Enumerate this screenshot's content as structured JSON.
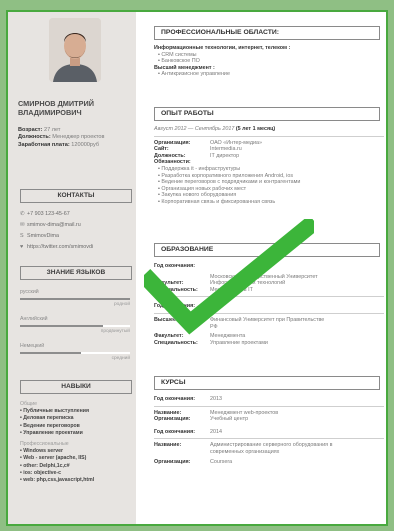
{
  "colors": {
    "accent": "#49a93f",
    "sidebar": "#e7e4e1",
    "background": "#8fbf84"
  },
  "profile": {
    "name": "СМИРНОВ ДМИТРИЙ ВЛАДИМИРОВИЧ",
    "age_label": "Возраст:",
    "age": "27 лет",
    "position_label": "Должность:",
    "position": "Менеджер проектов",
    "salary_label": "Заработная плата:",
    "salary": "120000руб"
  },
  "contacts": {
    "title": "КОНТАКТЫ",
    "items": [
      {
        "icon": "phone-icon",
        "text": "+7 903 123-45-67"
      },
      {
        "icon": "mail-icon",
        "text": "smimov-dima@mail.ru"
      },
      {
        "icon": "skype-icon",
        "text": "SmimovDima"
      },
      {
        "icon": "twitter-icon",
        "text": "https://twitter.com/smimovdi"
      }
    ]
  },
  "languages": {
    "title": "ЗНАНИЕ ЯЗЫКОВ",
    "items": [
      {
        "name": "русский",
        "level": "родной",
        "fill": 1.0
      },
      {
        "name": "Английский",
        "level": "продвинутый",
        "fill": 0.75
      },
      {
        "name": "Немецкий",
        "level": "средний",
        "fill": 0.55
      }
    ]
  },
  "skills": {
    "title": "НАВЫКИ",
    "general_label": "Общие",
    "general": [
      "Публичные выступления",
      "Деловая переписка",
      "Ведение переговоров",
      "Управление проектами"
    ],
    "prof_label": "Профессиональные",
    "prof": [
      "Windows server",
      "Web - server (apache, IIS)",
      "other: Delphi,1c,c#",
      "ios: objective-c",
      "web: php,css,javascript,html"
    ]
  },
  "areas": {
    "title": "ПРОФЕССИОНАЛЬНЫЕ ОБЛАСТИ:",
    "group1": "Информационные технологии, интернет, телеком :",
    "group1_items": [
      "CRM системы",
      "Банковское ПО"
    ],
    "group2": "Высший менеджмент :",
    "group2_items": [
      "Антикризисное управление"
    ]
  },
  "experience": {
    "title": "ОПЫТ РАБОТЫ",
    "period": "Август 2012 — Сентябрь 2017",
    "duration": "(5 лет 1 месяц)",
    "org_label": "Организация:",
    "org": "ОАО «Интер-медиа»",
    "site_label": "Сайт:",
    "site": "Intermedia.ru",
    "pos_label": "Должность:",
    "pos": "IT директор",
    "duties_label": "Обязанности:",
    "duties": [
      "Поддержка it - инфраструктуры",
      "Разработка корпоративного приложения Android, ios",
      "Ведение переговоров с подрядчиками и контрагентами",
      "Организация новых рабочих мест",
      "Закупка нового оборудования",
      "Корпоративная связь и фиксированная связь"
    ]
  },
  "education": {
    "title": "ОБРАЗОВАНИЕ",
    "e1_year_label": "Год окончания:",
    "e1_year": "",
    "e1_school": "Московский Государственный Университет",
    "e1_faculty_label": "Факультет:",
    "e1_faculty": "Информационных технологий",
    "e1_spec_label": "Специальность:",
    "e1_spec": "Менеджмент в IT",
    "e2_year_label": "Год окончания:",
    "e2_year": "2014",
    "e2_school_label": "Высшее:",
    "e2_school": "Финансовый Университет при Правительстве РФ",
    "e2_faculty_label": "Факультет:",
    "e2_faculty": "Менеджмента",
    "e2_spec_label": "Специальность:",
    "e2_spec": "Управление проектами"
  },
  "courses": {
    "title": "КУРСЫ",
    "c1_year_label": "Год окончания:",
    "c1_year": "2013",
    "c1_name_label": "Название:",
    "c1_name": "Менеджмент web-проектов",
    "c1_org_label": "Организация:",
    "c1_org": "Учебный центр",
    "c2_year_label": "Год окончания:",
    "c2_year": "2014",
    "c2_name_label": "Название:",
    "c2_name": "Администрирование серверного оборудования в современных организациях",
    "c2_org_label": "Организация:",
    "c2_org": "Coursera"
  }
}
